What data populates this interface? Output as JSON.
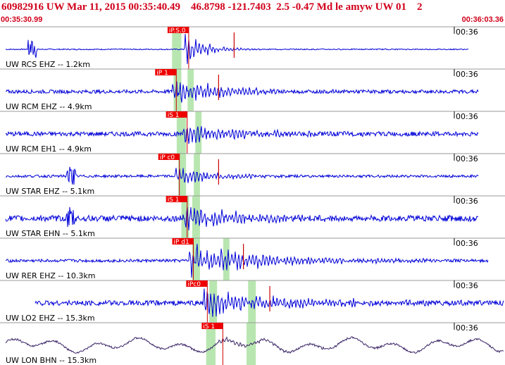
{
  "header": {
    "title": "60982916 UW Mar 11, 2015 00:35:40.49    46.8798 -121.7403  2.5 -0.47 Md le amyw UW 01    2",
    "start_time": "00:35:30.99",
    "end_time": "00:36:03.36"
  },
  "colors": {
    "header_text": "#d0001a",
    "trace": "#0000d8",
    "trace_lp": "#3a2466",
    "pick_box": "#ee0000",
    "pick_line": "#cc0000",
    "window": "#b8e6b0",
    "divider": "#9a9a9a"
  },
  "time_axis": {
    "start_s": 0,
    "end_s": 32.37,
    "tick_label": "00:36"
  },
  "traces": [
    {
      "label": "UW RCS EHZ -- 1.2km",
      "pick": "iP.S.0",
      "amp": 0.9,
      "noise": 0.05,
      "decay": 1.4,
      "pick_t": 11.8,
      "s_t": 15.0,
      "wins": [
        [
          11.0,
          11.6
        ]
      ],
      "lp": false,
      "spike_t": 2.0,
      "data_end": 0.93
    },
    {
      "label": "UW RCM EHZ -- 4.9km",
      "pick": "iP 1",
      "amp": 0.8,
      "noise": 0.18,
      "decay": 3.0,
      "pick_t": 11.0,
      "s_t": 14.0,
      "wins": [
        [
          11.1,
          11.6
        ],
        [
          12.0,
          12.4
        ]
      ],
      "lp": false,
      "spike_t": 0,
      "data_end": 0.95
    },
    {
      "label": "UW RCM EH1 -- 4.9km",
      "pick": "iS 1",
      "amp": 0.6,
      "noise": 0.22,
      "decay": 3.5,
      "pick_t": 11.7,
      "s_t": 0,
      "wins": [
        [
          11.3,
          11.9
        ],
        [
          12.5,
          12.9
        ]
      ],
      "lp": false,
      "spike_t": 0,
      "data_end": 0.95
    },
    {
      "label": "UW STAR EHZ -- 5.1km",
      "pick": "iP c0",
      "amp": 0.5,
      "noise": 0.13,
      "decay": 2.5,
      "pick_t": 11.2,
      "s_t": 14.0,
      "wins": [
        [
          11.4,
          11.9
        ],
        [
          12.4,
          12.8
        ]
      ],
      "lp": false,
      "spike_t": 4.5,
      "data_end": 0.95
    },
    {
      "label": "UW STAR EHN -- 5.1km",
      "pick": "iS 1",
      "amp": 0.8,
      "noise": 0.3,
      "decay": 3.0,
      "pick_t": 11.7,
      "s_t": 0,
      "wins": [
        [
          11.6,
          12.1
        ],
        [
          12.3,
          12.8
        ]
      ],
      "lp": false,
      "spike_t": 4.5,
      "data_end": 0.95
    },
    {
      "label": "UW RER EHZ -- 10.3km",
      "pick": "iP d1",
      "amp": 0.9,
      "noise": 0.15,
      "decay": 5.0,
      "pick_t": 12.1,
      "s_t": 15.6,
      "wins": [
        [
          12.3,
          12.8
        ],
        [
          14.3,
          14.7
        ]
      ],
      "lp": false,
      "spike_t": 0,
      "data_end": 0.97
    },
    {
      "label": "UW LO2 EHZ -- 15.3km",
      "pick": "iPc0",
      "amp": 0.7,
      "noise": 0.25,
      "decay": 5.5,
      "pick_t": 13.0,
      "s_t": 17.3,
      "wins": [
        [
          13.4,
          13.9
        ],
        [
          15.9,
          16.4
        ]
      ],
      "lp": false,
      "spike_t": 0,
      "data_end": 1.0
    },
    {
      "label": "UW LON BHN -- 15.3km",
      "pick": "iS 1",
      "amp": 0.35,
      "noise": 0.25,
      "decay": 4.0,
      "pick_t": 14.0,
      "s_t": 0,
      "wins": [
        [
          13.2,
          13.8
        ],
        [
          15.8,
          16.4
        ]
      ],
      "lp": true,
      "spike_t": 0,
      "data_end": 1.0
    }
  ]
}
